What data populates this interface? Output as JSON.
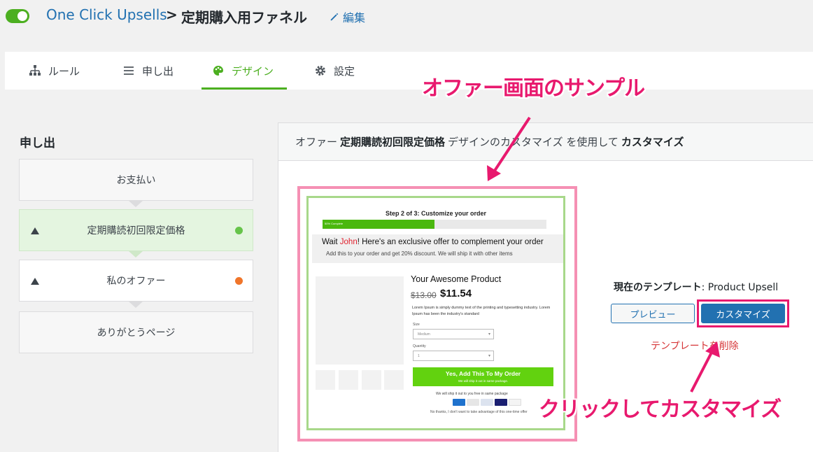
{
  "header": {
    "app_name": "One Click Upsells",
    "separator": ">",
    "funnel_title": "定期購入用ファネル",
    "edit_label": "編集",
    "toggle_on": true
  },
  "tabs": [
    {
      "label": "ルール",
      "icon": "sitemap-icon",
      "active": false
    },
    {
      "label": "申し出",
      "icon": "list-icon",
      "active": false
    },
    {
      "label": "デザイン",
      "icon": "palette-icon",
      "active": true
    },
    {
      "label": "設定",
      "icon": "gear-icon",
      "active": false
    }
  ],
  "sidebar": {
    "title": "申し出",
    "steps": [
      {
        "label": "お支払い",
        "arrow": false,
        "status": null
      },
      {
        "label": "定期購読初回限定価格",
        "arrow": true,
        "status": "#66c44a",
        "current": true
      },
      {
        "label": "私のオファー",
        "arrow": true,
        "status": "#f0752a"
      },
      {
        "label": "ありがとうページ",
        "arrow": false,
        "status": null
      }
    ]
  },
  "panel": {
    "head_prefix": "オファー",
    "offer_name": "定期購読初回限定価格",
    "head_mid": "デザインのカスタマイズ を使用して",
    "head_action": "カスタマイズ"
  },
  "preview": {
    "step_text": "Step 2 of 3: Customize your order",
    "progress_percent": 50,
    "progress_label": "50% Complete",
    "banner_wait": "Wait ",
    "banner_name": "John",
    "banner_rest": "! Here's an exclusive offer to complement your order",
    "banner_sub": "Add this to your order and get 20% discount. We will ship it with other items",
    "product_name": "Your Awesome Product",
    "old_price": "$13.00",
    "new_price": "$11.54",
    "description": "Lorem Ipsum is simply dummy text of the printing and typesetting industry. Lorem Ipsum has been the industry's standard",
    "size_label": "Size",
    "size_value": "Medium",
    "qty_label": "Quantity",
    "qty_value": "1",
    "cta_title": "Yes, Add This To My Order",
    "cta_sub": "We will ship it out in same package.",
    "ship_text": "We will ship it out to you free in same package",
    "decline_text": "No thanks, I don't want to take advantage of this one-time offer"
  },
  "template": {
    "current_label": "現在のテンプレート",
    "current_value": ": Product Upsell",
    "preview_button": "プレビュー",
    "customize_button": "カスタマイズ",
    "delete_link": "テンプレートを削除"
  },
  "annotations": {
    "top": "オファー画面のサンプル",
    "bottom": "クリックしてカスタマイズ",
    "color": "#e8196e"
  },
  "colors": {
    "accent_green": "#4caf20",
    "link_blue": "#2271b1",
    "danger_red": "#d63638"
  }
}
